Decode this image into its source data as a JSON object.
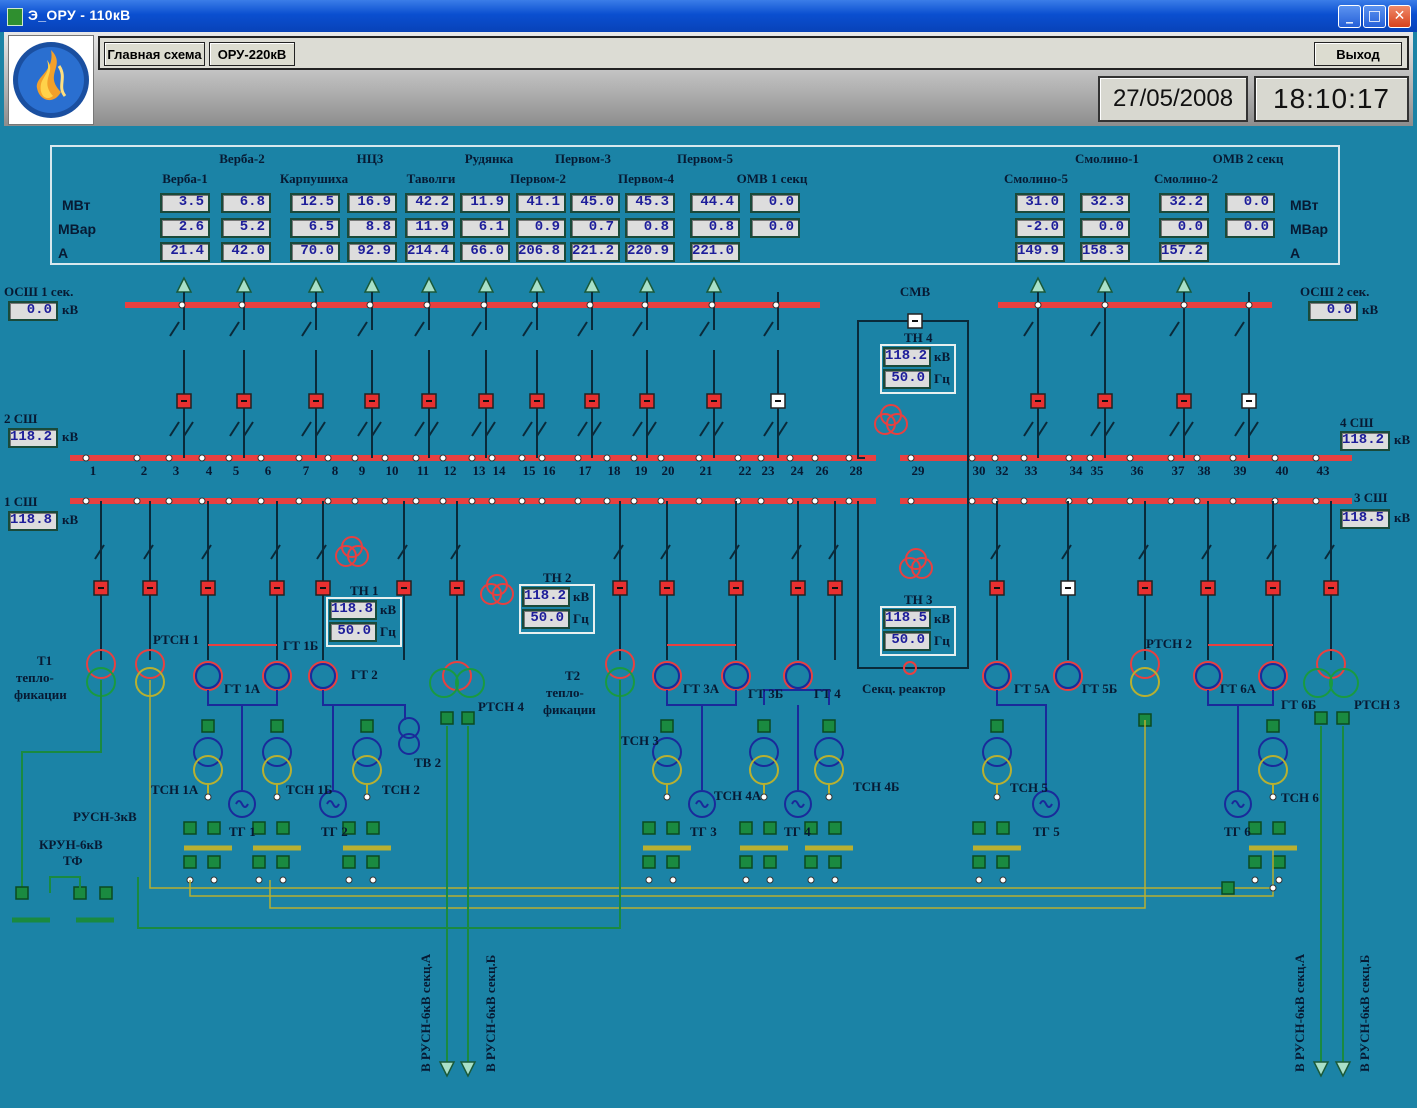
{
  "window": {
    "title": "Э_ОРУ - 110кВ",
    "min": "_",
    "max": "□",
    "close": "✕"
  },
  "menu": {
    "main": "Главная схема",
    "oru220": "ОРУ-220кВ",
    "exit": "Выход"
  },
  "clock": {
    "date": "27/05/2008",
    "time": "18:10:17"
  },
  "table": {
    "row_labels": {
      "mw": "МВт",
      "mvar": "МВар",
      "a": "А"
    },
    "top_names": [
      "Верба-2",
      "НЦ3",
      "Рудянка",
      "Первом-3",
      "Первом-5",
      "Смолино-1",
      "ОМВ  2 секц"
    ],
    "sub_names": [
      "Верба-1",
      "Карпушиха",
      "Таволги",
      "Первом-2",
      "Первом-4",
      "ОМВ 1 секц",
      "Смолино-5",
      "Смолино-2"
    ],
    "mw": [
      "3.5",
      "6.8",
      "12.5",
      "16.9",
      "42.2",
      "11.9",
      "41.1",
      "45.0",
      "45.3",
      "44.4",
      "0.0",
      "31.0",
      "32.3",
      "32.2",
      "0.0"
    ],
    "mvar": [
      "2.6",
      "5.2",
      "6.5",
      "8.8",
      "11.9",
      "6.1",
      "0.9",
      "0.7",
      "0.8",
      "0.8",
      "0.0",
      "-2.0",
      "0.0",
      "0.0",
      "0.0"
    ],
    "amps": [
      "21.4",
      "42.0",
      "70.0",
      "92.9",
      "214.4",
      "66.0",
      "206.8",
      "221.2",
      "220.9",
      "221.0",
      "149.9",
      "158.3",
      "157.2"
    ]
  },
  "bus": {
    "osh1": {
      "label": "ОСШ 1 сек.",
      "value": "0.0",
      "unit": "кВ"
    },
    "osh2": {
      "label": "ОСШ 2 сек.",
      "value": "0.0",
      "unit": "кВ"
    },
    "s2": {
      "label": "2 СШ",
      "value": "118.2",
      "unit": "кВ"
    },
    "s1": {
      "label": "1 СШ",
      "value": "118.8",
      "unit": "кВ"
    },
    "s4": {
      "label": "4 СШ",
      "value": "118.2",
      "unit": "кВ"
    },
    "s3": {
      "label": "3 СШ",
      "value": "118.5",
      "unit": "кВ"
    }
  },
  "tn": {
    "tn1": {
      "label": "ТН 1",
      "kv": "118.8",
      "hz": "50.0"
    },
    "tn2": {
      "label": "ТН 2",
      "kv": "118.2",
      "hz": "50.0"
    },
    "tn3": {
      "label": "ТН 3",
      "kv": "118.5",
      "hz": "50.0"
    },
    "tn4": {
      "label": "ТН 4",
      "kv": "118.2",
      "hz": "50.0"
    },
    "unit_kv": "кВ",
    "unit_hz": "Гц"
  },
  "cell_numbers": [
    "1",
    "2",
    "3",
    "4",
    "5",
    "6",
    "7",
    "8",
    "9",
    "10",
    "11",
    "12",
    "13",
    "14",
    "15",
    "16",
    "17",
    "18",
    "19",
    "20",
    "21",
    "22",
    "23",
    "24",
    "26",
    "28",
    "29",
    "30",
    "32",
    "33",
    "34",
    "35",
    "36",
    "37",
    "38",
    "39",
    "40",
    "43"
  ],
  "labels": {
    "smv": "СМВ",
    "sek_reactor": "Секц. реактор",
    "t1": [
      "Т1",
      "тепло-",
      "фикации"
    ],
    "t2": [
      "Т2",
      "тепло-",
      "фикации"
    ],
    "rtsn1": "РТСН 1",
    "rtsn2": "РТСН 2",
    "rtsn3": "РТСН 3",
    "rtsn4": "РТСН 4",
    "gt1a": "ГТ 1А",
    "gt1b": "ГТ 1Б",
    "gt2": "ГТ 2",
    "gt3a": "ГТ 3А",
    "gt3b": "ГТ 3Б",
    "gt4": "ГТ 4",
    "gt4a": "ТСН 4А",
    "gt4b": "ТСН 4Б",
    "gt5a": "ГТ 5А",
    "gt5b": "ГТ 5Б",
    "gt6a": "ГТ 6А",
    "gt6b": "ГТ 6Б",
    "tsn1a": "ТСН 1А",
    "tsn1b": "ТСН 1Б",
    "tsn2": "ТСН 2",
    "tsn3": "ТСН 3",
    "tsn5": "ТСН 5",
    "tsn6": "ТСН 6",
    "tv2": "ТВ 2",
    "tg1": "ТГ 1",
    "tg2": "ТГ 2",
    "tg3": "ТГ 3",
    "tg4": "ТГ 4",
    "tg5": "ТГ 5",
    "tg6": "ТГ 6",
    "rusn3": "РУСН-3кВ",
    "krun": "КРУН-6кВ",
    "tf": "ТФ",
    "out1": "В РУСН-6кВ секц.А",
    "out2": "В РУСН-6кВ секц.Б",
    "out3": "В РУСН-6кВ секц.А",
    "out4": "В РУСН-6кВ секц.Б"
  },
  "colors": {
    "background": "#1b83a6",
    "bus": "#e84040",
    "breaker": "#e83030",
    "wire_dark": "#0a2a3a",
    "generator": "#1a2a9a",
    "aux": "#1a8040",
    "yellow_line": "#b8b030"
  }
}
